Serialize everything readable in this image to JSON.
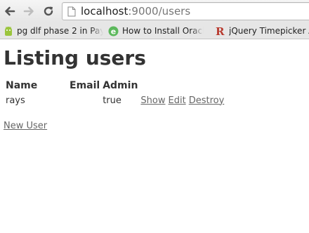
{
  "browser": {
    "url_host": "localhost",
    "url_rest": ":9000/users",
    "bookmarks": [
      {
        "label": "pg dlf phase 2 in Pay",
        "icon": "android-icon"
      },
      {
        "label": "How to Install Oracle",
        "icon": "e-logo-icon"
      },
      {
        "label": "jQuery Timepicker A",
        "icon": "r-logo-icon"
      }
    ]
  },
  "page": {
    "title": "Listing users",
    "columns": [
      "Name",
      "Email",
      "Admin"
    ],
    "rows": [
      {
        "name": "rays",
        "email": "",
        "admin": "true",
        "actions": {
          "show": "Show",
          "edit": "Edit",
          "destroy": "Destroy"
        }
      }
    ],
    "new_user_link": "New User"
  },
  "colors": {
    "android_green": "#9bc53d",
    "e_logo_green": "#5cb85c",
    "r_logo_red": "#b83a2e",
    "link": "#666666"
  }
}
